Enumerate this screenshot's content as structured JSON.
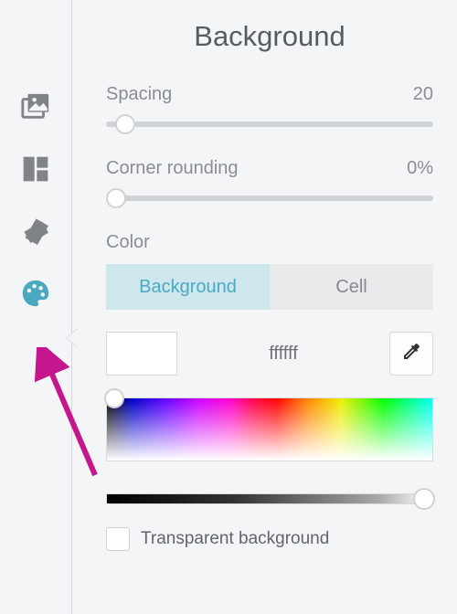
{
  "title": "Background",
  "spacing": {
    "label": "Spacing",
    "value": "20",
    "pct": 6
  },
  "rounding": {
    "label": "Corner rounding",
    "value": "0%",
    "pct": 3
  },
  "colorSection": {
    "label": "Color"
  },
  "tabs": {
    "background": "Background",
    "cell": "Cell",
    "active": "background"
  },
  "swatch": {
    "hex": "ffffff",
    "color": "#ffffff"
  },
  "lightness": {
    "pct": 100
  },
  "transparent": {
    "label": "Transparent background",
    "checked": false
  },
  "sidebar": {
    "items": [
      {
        "name": "images",
        "active": false
      },
      {
        "name": "layout",
        "active": false
      },
      {
        "name": "tags",
        "active": false
      },
      {
        "name": "palette",
        "active": true
      }
    ]
  }
}
